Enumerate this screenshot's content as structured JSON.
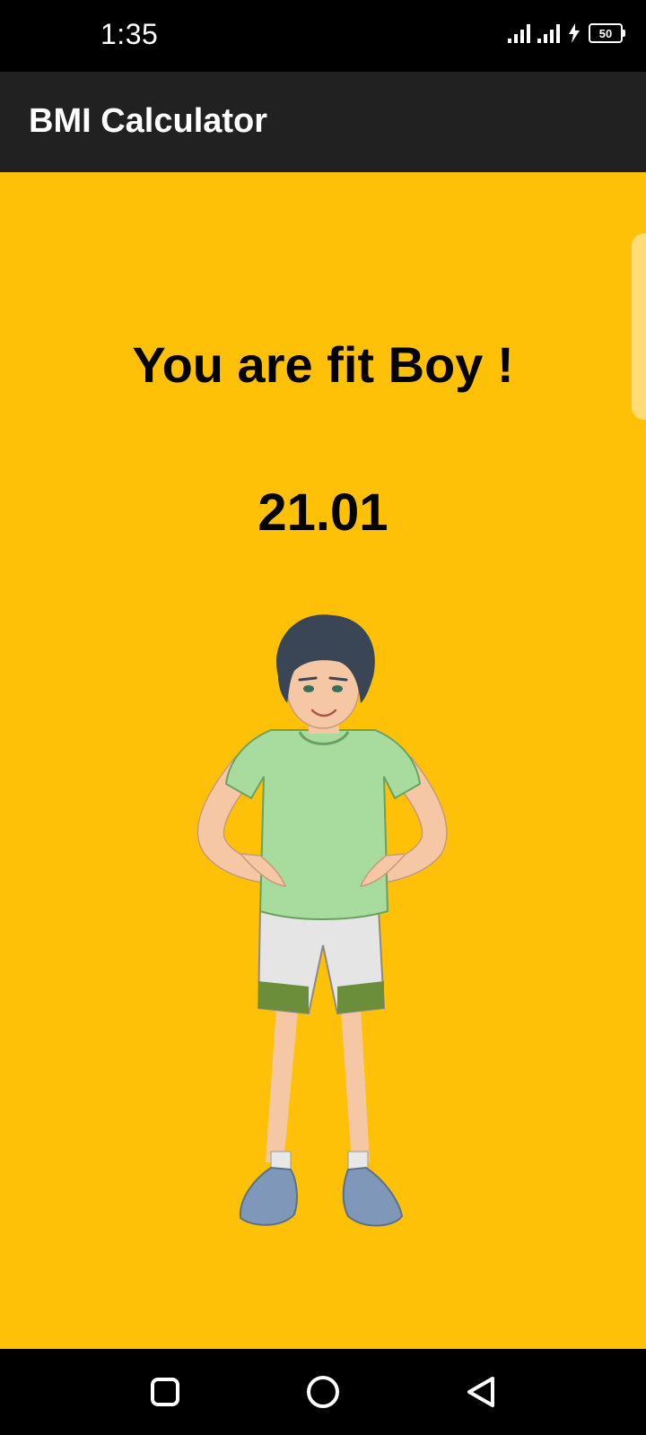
{
  "status_bar": {
    "time": "1:35",
    "battery": "50",
    "icons": [
      "signal-icon",
      "signal-icon",
      "charging-icon",
      "battery-icon"
    ]
  },
  "app_bar": {
    "title": "BMI Calculator"
  },
  "result": {
    "message": "You are fit Boy !",
    "bmi": "21.01",
    "illustration": "fit-boy-illustration"
  },
  "nav_bar": {
    "buttons": [
      "recents-icon",
      "home-icon",
      "back-icon"
    ]
  },
  "colors": {
    "background": "#FFC107",
    "app_bar": "#212121",
    "status_bar": "#000000",
    "text": "#000000"
  }
}
